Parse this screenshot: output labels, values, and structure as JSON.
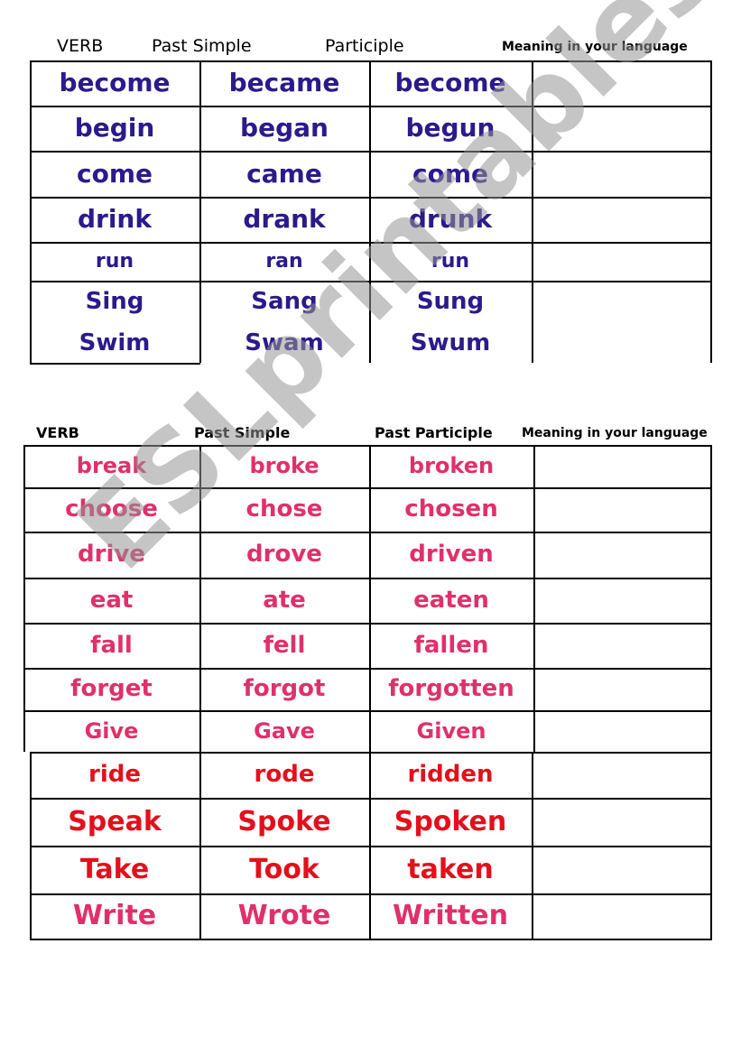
{
  "section1": {
    "headers": [
      "VERB",
      "Past Simple",
      "Participle",
      "Meaning in your language"
    ],
    "rows": [
      [
        "become",
        "became",
        "become",
        ""
      ],
      [
        "begin",
        "began",
        "begun",
        ""
      ],
      [
        "come",
        "came",
        "come",
        ""
      ],
      [
        "drink",
        "drank",
        "drunk",
        ""
      ],
      [
        "run",
        "ran",
        "run",
        ""
      ],
      [
        "Sing",
        "Sang",
        "Sung",
        ""
      ],
      [
        "Swim",
        "Swam",
        "Swum",
        ""
      ]
    ]
  },
  "section2": {
    "headers": [
      "VERB",
      "Past Simple",
      "Past Participle",
      "Meaning in your language"
    ],
    "rows": [
      [
        "break",
        "broke",
        "broken",
        ""
      ],
      [
        "choose",
        "chose",
        "chosen",
        ""
      ],
      [
        "drive",
        "drove",
        "driven",
        ""
      ],
      [
        "eat",
        "ate",
        "eaten",
        ""
      ],
      [
        "fall",
        "fell",
        "fallen",
        ""
      ],
      [
        "forget",
        "forgot",
        "forgotten",
        ""
      ],
      [
        "Give",
        "Gave",
        "Given",
        ""
      ],
      [
        "ride",
        "rode",
        "ridden",
        ""
      ],
      [
        "Speak",
        "Spoke",
        "Spoken",
        ""
      ],
      [
        "Take",
        "Took",
        "taken",
        ""
      ],
      [
        "Write",
        "Wrote",
        "Written",
        ""
      ]
    ]
  },
  "watermark": "ESLprintables.com",
  "colors": {
    "blue": "#2b1a8c",
    "pink": "#e0306a",
    "red": "#e3101c"
  }
}
